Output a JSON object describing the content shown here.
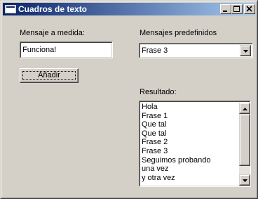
{
  "window": {
    "title": "Cuadros de texto"
  },
  "custom": {
    "label": "Mensaje a medida:",
    "value": "Funciona!"
  },
  "add_button": {
    "label": "Añadir"
  },
  "predefined": {
    "label": "Mensajes predefinidos",
    "selected": "Frase 3"
  },
  "result": {
    "label": "Resultado:",
    "items": [
      "Hola",
      "Frase 1",
      "Que tal",
      "Que tal",
      "Frase 2",
      "Frase 3",
      "Seguimos probando",
      "una vez",
      "y otra vez"
    ]
  },
  "icons": {
    "minimize": "minimize-icon",
    "maximize": "maximize-icon",
    "close": "close-icon",
    "dropdown": "chevron-down-icon",
    "scroll_up": "scroll-up-icon",
    "scroll_down": "scroll-down-icon"
  }
}
